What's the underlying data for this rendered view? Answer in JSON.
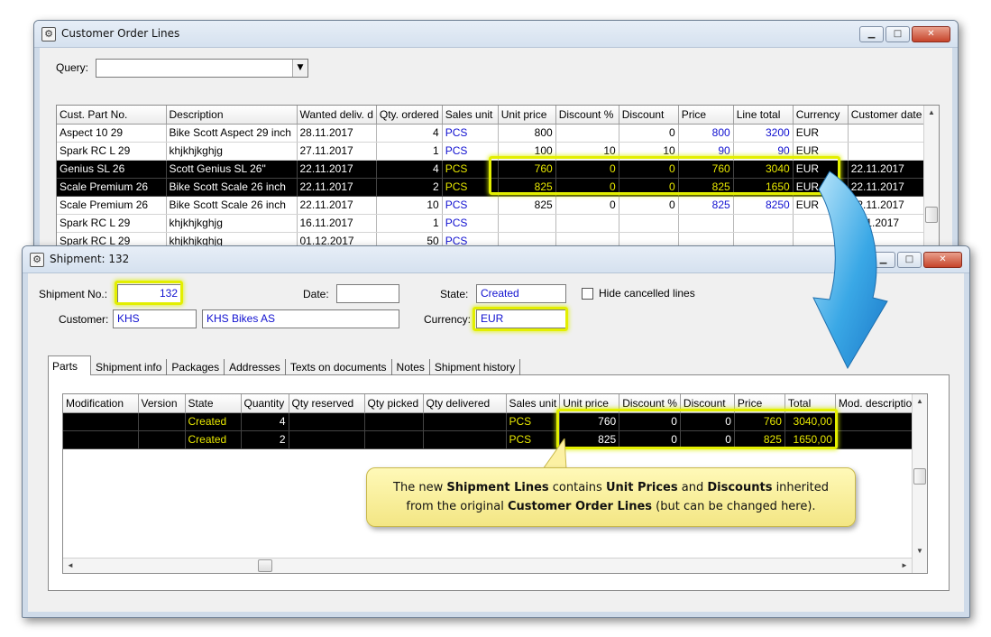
{
  "colors": {
    "highlight": "#e3ef00",
    "selected_row_bg": "#000000",
    "selected_row_text": "#e8e800",
    "link_blue": "#1010d0",
    "callout_bg": "#fff6a8",
    "arrow_blue": "#2a9ee0"
  },
  "order_window": {
    "title": "Customer Order Lines",
    "query_label": "Query:",
    "query_value": "",
    "columns": [
      "Cust. Part No.",
      "Description",
      "Wanted deliv. d",
      "Qty. ordered",
      "Sales unit",
      "Unit price",
      "Discount %",
      "Discount",
      "Price",
      "Line total",
      "Currency",
      "Customer date"
    ],
    "rows": [
      {
        "part": "Aspect 10 29",
        "desc": "Bike Scott Aspect 29 inch",
        "wanted": "28.11.2017",
        "qty": "4",
        "unit": "PCS",
        "unit_price": "800",
        "disc_pct": "",
        "disc": "0",
        "price": "800",
        "line_total": "3200",
        "currency": "EUR",
        "cust_date": "",
        "selected": false
      },
      {
        "part": "Spark RC L 29",
        "desc": "khjkhjkghjg",
        "wanted": "27.11.2017",
        "qty": "1",
        "unit": "PCS",
        "unit_price": "100",
        "disc_pct": "10",
        "disc": "10",
        "price": "90",
        "line_total": "90",
        "currency": "EUR",
        "cust_date": "",
        "selected": false
      },
      {
        "part": "Genius SL 26",
        "desc": "Scott Genius SL 26\"",
        "wanted": "22.11.2017",
        "qty": "4",
        "unit": "PCS",
        "unit_price": "760",
        "disc_pct": "0",
        "disc": "0",
        "price": "760",
        "line_total": "3040",
        "currency": "EUR",
        "cust_date": "22.11.2017",
        "selected": true
      },
      {
        "part": "Scale Premium 26",
        "desc": "Bike Scott Scale 26 inch",
        "wanted": "22.11.2017",
        "qty": "2",
        "unit": "PCS",
        "unit_price": "825",
        "disc_pct": "0",
        "disc": "0",
        "price": "825",
        "line_total": "1650",
        "currency": "EUR",
        "cust_date": "22.11.2017",
        "selected": true
      },
      {
        "part": "Scale Premium 26",
        "desc": "Bike Scott Scale 26 inch",
        "wanted": "22.11.2017",
        "qty": "10",
        "unit": "PCS",
        "unit_price": "825",
        "disc_pct": "0",
        "disc": "0",
        "price": "825",
        "line_total": "8250",
        "currency": "EUR",
        "cust_date": "22.11.2017",
        "selected": false
      },
      {
        "part": "Spark RC L 29",
        "desc": "khjkhjkghjg",
        "wanted": "16.11.2017",
        "qty": "1",
        "unit": "PCS",
        "unit_price": "",
        "disc_pct": "",
        "disc": "",
        "price": "",
        "line_total": "",
        "currency": "",
        "cust_date": "01.1.2017",
        "selected": false
      },
      {
        "part": "Spark RC L 29",
        "desc": "khjkhjkghjg",
        "wanted": "01.12.2017",
        "qty": "50",
        "unit": "PCS",
        "unit_price": "",
        "disc_pct": "",
        "disc": "",
        "price": "",
        "line_total": "",
        "currency": "",
        "cust_date": "",
        "selected": false
      }
    ]
  },
  "shipment_window": {
    "title": "Shipment: 132",
    "shipment_no_label": "Shipment No.:",
    "shipment_no": "132",
    "date_label": "Date:",
    "date_value": "",
    "state_label": "State:",
    "state_value": "Created",
    "hide_cancelled_label": "Hide cancelled lines",
    "customer_label": "Customer:",
    "customer_code": "KHS",
    "customer_name": "KHS Bikes AS",
    "currency_label": "Currency:",
    "currency_value": "EUR",
    "tabs": [
      "Parts",
      "Shipment info",
      "Packages",
      "Addresses",
      "Texts on documents",
      "Notes",
      "Shipment history"
    ],
    "active_tab": "Parts",
    "columns": [
      "Modification",
      "Version",
      "State",
      "Quantity",
      "Qty reserved",
      "Qty picked",
      "Qty delivered",
      "Sales unit",
      "Unit price",
      "Discount %",
      "Discount",
      "Price",
      "Total",
      "Mod. descriptio"
    ],
    "rows": [
      {
        "mod": "",
        "version": "",
        "state": "Created",
        "qty": "4",
        "reserved": "",
        "picked": "",
        "delivered": "",
        "unit": "PCS",
        "unit_price": "760",
        "disc_pct": "0",
        "disc": "0",
        "price": "760",
        "total": "3040,00",
        "mod_desc": ""
      },
      {
        "mod": "",
        "version": "",
        "state": "Created",
        "qty": "2",
        "reserved": "",
        "picked": "",
        "delivered": "",
        "unit": "PCS",
        "unit_price": "825",
        "disc_pct": "0",
        "disc": "0",
        "price": "825",
        "total": "1650,00",
        "mod_desc": ""
      }
    ]
  },
  "callout": {
    "segments": [
      {
        "text": "The new ",
        "bold": false
      },
      {
        "text": "Shipment Lines",
        "bold": true
      },
      {
        "text": " contains ",
        "bold": false
      },
      {
        "text": "Unit Prices",
        "bold": true
      },
      {
        "text": " and ",
        "bold": false
      },
      {
        "text": "Discounts",
        "bold": true
      },
      {
        "text": " inherited",
        "bold": false
      },
      {
        "text": "\n",
        "bold": false
      },
      {
        "text": "from the original ",
        "bold": false
      },
      {
        "text": "Customer Order Lines",
        "bold": true
      },
      {
        "text": " (but can be changed here).",
        "bold": false
      }
    ]
  }
}
